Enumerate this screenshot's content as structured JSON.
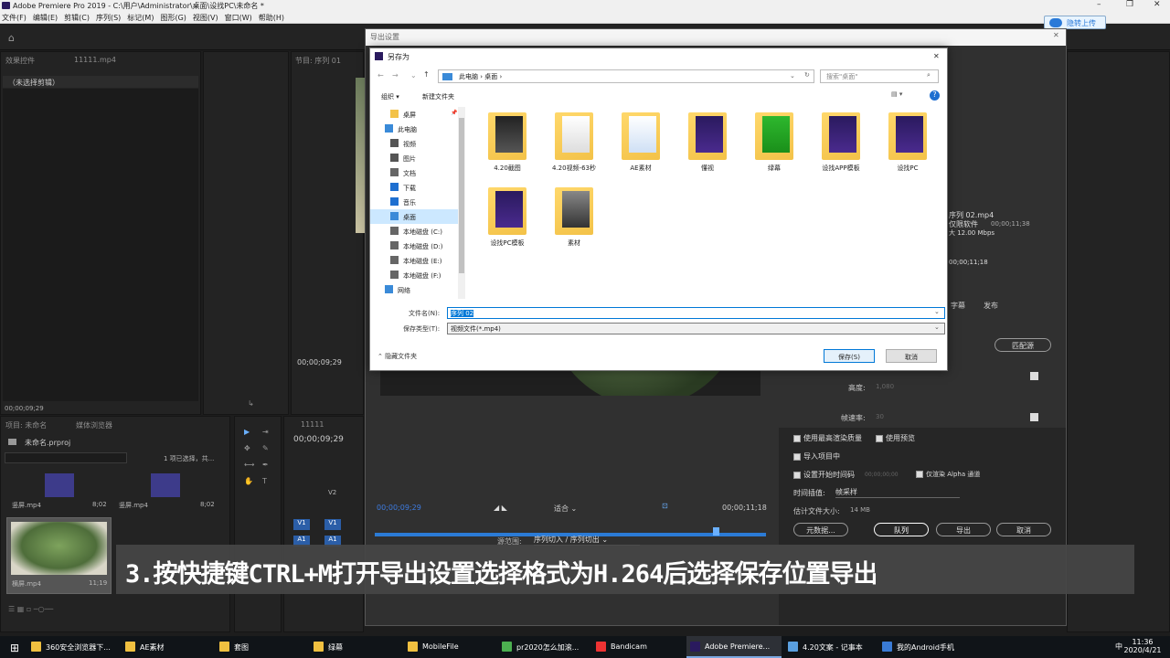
{
  "window": {
    "title": "Adobe Premiere Pro 2019 - C:\\用户\\Administrator\\桌面\\设找PC\\未命名 *"
  },
  "menu": [
    "文件(F)",
    "编辑(E)",
    "剪辑(C)",
    "序列(S)",
    "标记(M)",
    "图形(G)",
    "视图(V)",
    "窗口(W)",
    "帮助(H)"
  ],
  "upload_button": "隐转上传",
  "panels": {
    "effect_controls_tab": "效果控件",
    "source_tab": "11111.mp4",
    "no_clip": "（未选择剪辑）",
    "timecode_left": "00;00;09;29",
    "program_tab": "节目: 序列 01",
    "seq_timecode": "00;00;09;29",
    "project_tab": "项目: 未命名",
    "media_browser_tab": "媒体浏览器",
    "project_file": "未命名.prproj",
    "selection_info": "1 项已选择，共...",
    "clips": [
      {
        "name": "竖屏.mp4",
        "dur": "8;02"
      },
      {
        "name": "竖屏.mp4",
        "dur": "8;02"
      },
      {
        "name": "横屏.mp4",
        "dur": "11;19"
      }
    ],
    "timeline_tab": "11111",
    "timeline_timecode": "00;00;09;29",
    "tracks": [
      "V2",
      "V1",
      "A1"
    ]
  },
  "export": {
    "title": "导出设置",
    "timecode_in": "00;00;09;29",
    "timecode_out": "00;00;11;18",
    "fit": "适合",
    "source_range_label": "源范围:",
    "source_range_value": "序列切入 / 序列切出",
    "output_name": "序列 02.mp4",
    "output_path": "仅限软件",
    "output_dur": "00;00;11;38",
    "bitrate": "大 12.00 Mbps",
    "source_dur": "00;00;11;18",
    "tabs": [
      "字幕",
      "发布"
    ],
    "match_source": "匹配源",
    "height_label": "高度:",
    "height_value": "1,080",
    "framerate_label": "帧速率:",
    "framerate_value": "30",
    "use_max_quality": "使用最高渲染质量",
    "use_previews": "使用预览",
    "import_project": "导入项目中",
    "set_start_timecode": "设置开始时间码",
    "start_timecode_value": "00;00;00;00",
    "render_alpha": "仅渲染 Alpha 通道",
    "interp_label": "时间插值:",
    "interp_value": "帧采样",
    "file_size_label": "估计文件大小:",
    "file_size_value": "14 MB",
    "btn_meta": "元数据...",
    "btn_queue": "队列",
    "btn_export": "导出",
    "btn_cancel": "取消"
  },
  "save_dialog": {
    "title": "另存为",
    "address": [
      "此电脑",
      "桌面"
    ],
    "search_placeholder": "搜索\"桌面\"",
    "organize": "组织 ▾",
    "new_folder": "新建文件夹",
    "nav": [
      {
        "label": "桌屏",
        "pin": true,
        "indent": 1,
        "icon": "folder"
      },
      {
        "label": "此电脑",
        "indent": 0,
        "icon": "pc"
      },
      {
        "label": "视频",
        "indent": 1,
        "icon": "video"
      },
      {
        "label": "图片",
        "indent": 1,
        "icon": "picture"
      },
      {
        "label": "文档",
        "indent": 1,
        "icon": "document"
      },
      {
        "label": "下载",
        "indent": 1,
        "icon": "download"
      },
      {
        "label": "音乐",
        "indent": 1,
        "icon": "music"
      },
      {
        "label": "桌面",
        "indent": 1,
        "icon": "desktop",
        "selected": true
      },
      {
        "label": "本地磁盘 (C:)",
        "indent": 1,
        "icon": "drive"
      },
      {
        "label": "本地磁盘 (D:)",
        "indent": 1,
        "icon": "drive"
      },
      {
        "label": "本地磁盘 (E:)",
        "indent": 1,
        "icon": "drive"
      },
      {
        "label": "本地磁盘 (F:)",
        "indent": 1,
        "icon": "drive"
      },
      {
        "label": "网络",
        "indent": 0,
        "icon": "network"
      }
    ],
    "files": [
      {
        "name": "4.20截图",
        "kind": "docs-dark"
      },
      {
        "name": "4.20视频-63秒",
        "kind": "docs-light"
      },
      {
        "name": "AE素材",
        "kind": "audio"
      },
      {
        "name": "懂视",
        "kind": "pr"
      },
      {
        "name": "绿幕",
        "kind": "green"
      },
      {
        "name": "设找APP模板",
        "kind": "pr"
      },
      {
        "name": "设找PC",
        "kind": "pr"
      },
      {
        "name": "设找PC模板",
        "kind": "pr"
      },
      {
        "name": "素材",
        "kind": "photo"
      }
    ],
    "filename_label": "文件名(N):",
    "filename_value": "序列 02",
    "filetype_label": "保存类型(T):",
    "filetype_value": "视频文件(*.mp4)",
    "hide_folders": "隐藏文件夹",
    "save_btn": "保存(S)",
    "cancel_btn": "取消"
  },
  "caption": "3.按快捷键CTRL+M打开导出设置选择格式为H.264后选择保存位置导出",
  "taskbar": {
    "items": [
      {
        "label": "360安全浏览器下...",
        "color": "#f0c040"
      },
      {
        "label": "AE素材",
        "color": "#f0c040"
      },
      {
        "label": "套图",
        "color": "#f0c040"
      },
      {
        "label": "绿幕",
        "color": "#f0c040"
      },
      {
        "label": "MobileFile",
        "color": "#f0c040"
      },
      {
        "label": "pr2020怎么加滚...",
        "color": "#4caf50"
      },
      {
        "label": "Bandicam",
        "color": "#e33"
      },
      {
        "label": "Adobe Premiere...",
        "color": "#2a1a5e",
        "active": true
      },
      {
        "label": "4.20文案 - 记事本",
        "color": "#5aa0e0"
      },
      {
        "label": "我的Android手机",
        "color": "#3a7bd5"
      }
    ],
    "time": "11:36",
    "date": "2020/4/21",
    "ime": "中"
  }
}
